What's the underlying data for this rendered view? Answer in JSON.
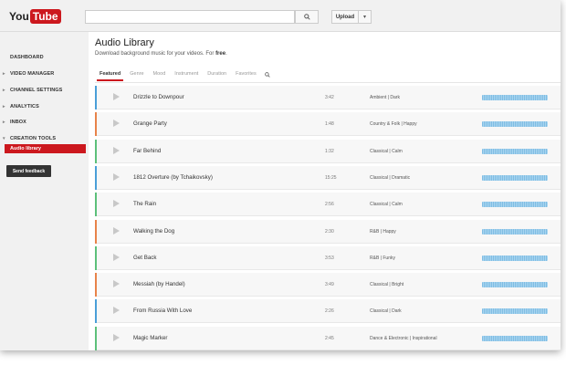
{
  "header": {
    "logo_you": "You",
    "logo_tube": "Tube",
    "search_placeholder": "",
    "upload_label": "Upload",
    "upload_caret": "▾"
  },
  "sidebar": {
    "items": [
      {
        "label": "Dashboard",
        "arrow": ""
      },
      {
        "label": "Video Manager",
        "arrow": "▸"
      },
      {
        "label": "Channel Settings",
        "arrow": "▸"
      },
      {
        "label": "Analytics",
        "arrow": "▸"
      },
      {
        "label": "Inbox",
        "arrow": "▸"
      },
      {
        "label": "Creation Tools",
        "arrow": "▾"
      }
    ],
    "active_item": "Audio library",
    "feedback_label": "Send feedback"
  },
  "main": {
    "title": "Audio Library",
    "subtitle_prefix": "Download background music for your videos. For ",
    "subtitle_bold": "free",
    "subtitle_suffix": ".",
    "tabs": [
      "Featured",
      "Genre",
      "Mood",
      "Instrument",
      "Duration",
      "Favorites"
    ],
    "active_tab": 0,
    "tracks": [
      {
        "name": "Drizzle to Downpour",
        "duration": "3:42",
        "tags": "Ambient | Dark",
        "color": "#4a9fd8"
      },
      {
        "name": "Grange Party",
        "duration": "1:48",
        "tags": "Country & Folk | Happy",
        "color": "#e8834a"
      },
      {
        "name": "Far Behind",
        "duration": "1:32",
        "tags": "Classical | Calm",
        "color": "#5cc07a"
      },
      {
        "name": "1812 Overture (by Tchaikovsky)",
        "duration": "15:25",
        "tags": "Classical | Dramatic",
        "color": "#4a9fd8"
      },
      {
        "name": "The Rain",
        "duration": "2:56",
        "tags": "Classical | Calm",
        "color": "#5cc07a"
      },
      {
        "name": "Walking the Dog",
        "duration": "2:30",
        "tags": "R&B | Happy",
        "color": "#e8834a"
      },
      {
        "name": "Get Back",
        "duration": "3:53",
        "tags": "R&B | Funky",
        "color": "#5cc07a"
      },
      {
        "name": "Messiah (by Handel)",
        "duration": "3:49",
        "tags": "Classical | Bright",
        "color": "#e8834a"
      },
      {
        "name": "From Russia With Love",
        "duration": "2:26",
        "tags": "Classical | Dark",
        "color": "#4a9fd8"
      },
      {
        "name": "Magic Marker",
        "duration": "2:45",
        "tags": "Dance & Electronic | Inspirational",
        "color": "#5cc07a"
      }
    ]
  },
  "icons": {
    "search": "search-icon",
    "play": "play-icon",
    "waveform": "waveform-icon"
  },
  "colors": {
    "brand_red": "#cc181e",
    "waveform_blue": "#7fbde3"
  }
}
